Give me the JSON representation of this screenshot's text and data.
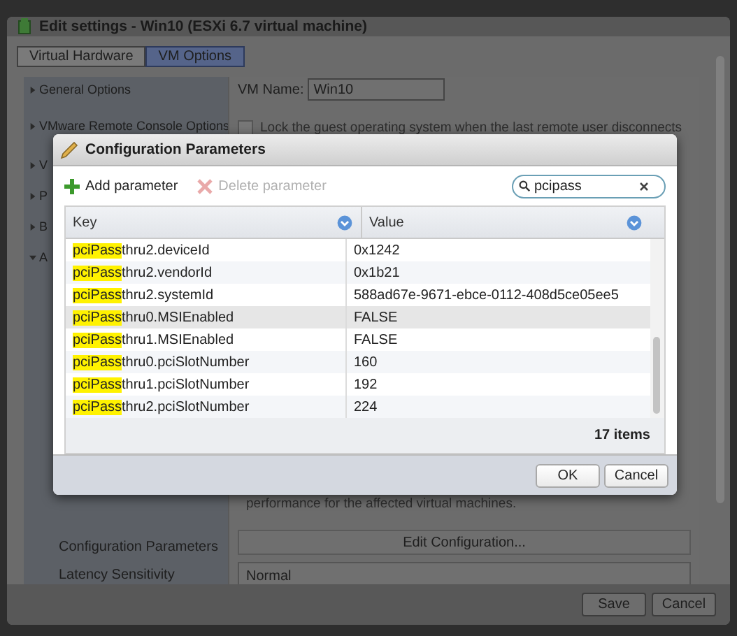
{
  "window": {
    "title": "Edit settings - Win10 (ESXi 6.7 virtual machine)"
  },
  "tabs": [
    {
      "label": "Virtual Hardware",
      "selected": false
    },
    {
      "label": "VM Options",
      "selected": true
    }
  ],
  "sidebar": {
    "items": [
      {
        "label": "General Options",
        "expanded": false
      },
      {
        "label": "VMware Remote Console Options",
        "expanded": false
      },
      {
        "label": "V",
        "expanded": false
      },
      {
        "label": "P",
        "expanded": false
      },
      {
        "label": "B",
        "expanded": false
      },
      {
        "label": "A",
        "expanded": true
      }
    ]
  },
  "general": {
    "vm_name_label": "VM Name:",
    "vm_name": "Win10"
  },
  "remote_console": {
    "lock_label": "Lock the guest operating system when the last remote user disconnects",
    "checked": false
  },
  "advanced": {
    "description": "performance for the affected virtual machines.",
    "rows": [
      {
        "label": "Configuration Parameters",
        "control": "Edit Configuration...",
        "kind": "button"
      },
      {
        "label": "Latency Sensitivity",
        "control": "Normal",
        "kind": "dropdown"
      }
    ]
  },
  "footer_buttons": [
    "Save",
    "Cancel"
  ],
  "dialog": {
    "title": "Configuration Parameters",
    "toolbar": [
      {
        "label": "Add parameter",
        "kind": "add",
        "disabled": false
      },
      {
        "label": "Delete parameter",
        "kind": "delete",
        "disabled": true
      }
    ],
    "search": {
      "value": "pcipass"
    },
    "columns": [
      "Key",
      "Value"
    ],
    "rows": [
      {
        "key_match": "pciPass",
        "key_rest": "thru2.deviceId",
        "value": "0x1242",
        "selected": false
      },
      {
        "key_match": "pciPass",
        "key_rest": "thru2.vendorId",
        "value": "0x1b21",
        "selected": false
      },
      {
        "key_match": "pciPass",
        "key_rest": "thru2.systemId",
        "value": "588ad67e-9671-ebce-0112-408d5ce05ee5",
        "selected": false
      },
      {
        "key_match": "pciPass",
        "key_rest": "thru0.MSIEnabled",
        "value": "FALSE",
        "selected": true
      },
      {
        "key_match": "pciPass",
        "key_rest": "thru1.MSIEnabled",
        "value": "FALSE",
        "selected": false
      },
      {
        "key_match": "pciPass",
        "key_rest": "thru0.pciSlotNumber",
        "value": "160",
        "selected": false
      },
      {
        "key_match": "pciPass",
        "key_rest": "thru1.pciSlotNumber",
        "value": "192",
        "selected": false
      },
      {
        "key_match": "pciPass",
        "key_rest": "thru2.pciSlotNumber",
        "value": "224",
        "selected": false
      }
    ],
    "count": "17 items",
    "buttons": [
      "OK",
      "Cancel"
    ]
  }
}
